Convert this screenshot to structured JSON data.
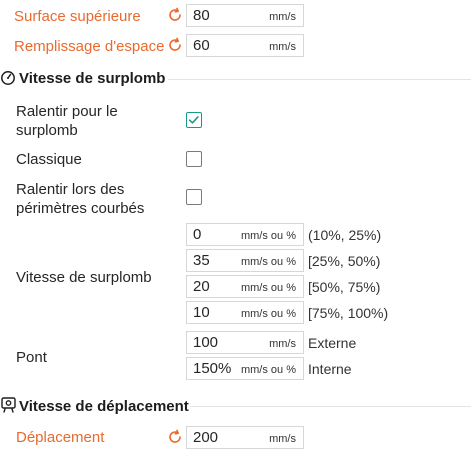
{
  "top_fields": [
    {
      "label": "Surface supérieure",
      "value": "80",
      "unit": "mm/s"
    },
    {
      "label": "Remplissage d'espace",
      "value": "60",
      "unit": "mm/s"
    }
  ],
  "overhang_section": {
    "title": "Vitesse de surplomb",
    "slow_down_label_line1": "Ralentir pour le",
    "slow_down_label_line2": "surplomb",
    "slow_down_checked": true,
    "classic_label": "Classique",
    "classic_checked": false,
    "curled_label_line1": "Ralentir lors des",
    "curled_label_line2": "périmètres courbés",
    "curled_checked": false,
    "overhang_speed_label": "Vitesse de surplomb",
    "overhang_rows": [
      {
        "value": "0",
        "unit": "mm/s ou %",
        "range": "(10%, 25%)"
      },
      {
        "value": "35",
        "unit": "mm/s ou %",
        "range": "[25%, 50%)"
      },
      {
        "value": "20",
        "unit": "mm/s ou %",
        "range": "[50%, 75%)"
      },
      {
        "value": "10",
        "unit": "mm/s ou %",
        "range": "[75%, 100%)"
      }
    ],
    "bridge_label": "Pont",
    "bridge_external": {
      "value": "100",
      "unit": "mm/s",
      "suffix": "Externe"
    },
    "bridge_internal": {
      "value": "150%",
      "unit": "mm/s ou %",
      "suffix": "Interne"
    }
  },
  "travel_section": {
    "title": "Vitesse de déplacement",
    "travel_label": "Déplacement",
    "travel_value": "200",
    "travel_unit": "mm/s"
  },
  "colors": {
    "accent_orange": "#ea6a2e",
    "check_green": "#199a84"
  },
  "icons": [
    "reset-arrow-icon",
    "speedometer-icon",
    "travel-icon",
    "checkmark-icon"
  ]
}
